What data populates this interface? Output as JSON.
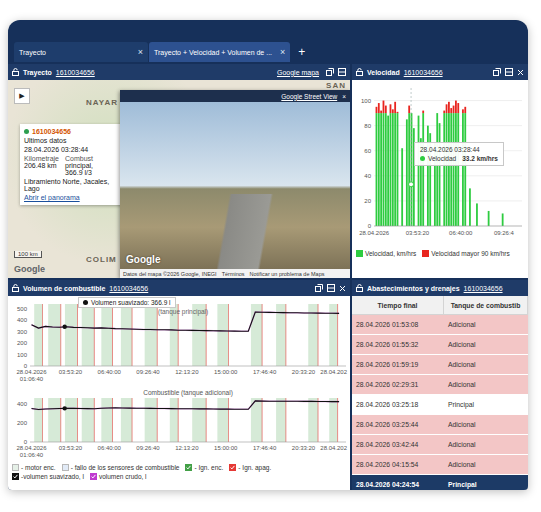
{
  "tabs": [
    {
      "label": "Trayecto",
      "close": "×",
      "selected": false
    },
    {
      "label": "Trayecto + Velocidad + Volumen de ...",
      "close": "×",
      "selected": true
    }
  ],
  "new_tab": "+",
  "map_panel": {
    "title": "Trayecto",
    "unit_id": "1610034656",
    "link": "Google mapa",
    "play": "▶",
    "places": [
      {
        "label": "NAYAR"
      },
      {
        "label": "SAN"
      },
      {
        "label": "COLIM"
      }
    ],
    "scale": "100 km",
    "logo": "Google",
    "info": {
      "unit": "1610034656",
      "status_color": "#2e9e4f",
      "heading": "Ultimos datos",
      "time": "28.04.2026 03:28:44",
      "fields": [
        {
          "label": "Kilometraje",
          "lines": [
            "206.48 km"
          ]
        },
        {
          "label": "Combust",
          "lines": [
            "principal,",
            "366.9 l/3"
          ]
        }
      ],
      "address": "Libramiento Norte, Jacales, Lago",
      "link": "Abrir el panorama"
    },
    "street_view": {
      "title": "Google Street View",
      "close": "×",
      "logo": "Google",
      "footer": [
        "Datos del mapa ©2026 Google, INEGI",
        "Términos",
        "Notificar un problema de Maps"
      ]
    }
  },
  "speed_panel": {
    "title": "Velocidad",
    "unit_id": "1610034656",
    "y_ticks": [
      "100",
      "80",
      "60",
      "40",
      "20",
      "0"
    ],
    "x_ticks": [
      {
        "lines": [
          "28.04.2026"
        ],
        "hour": 1.11
      },
      {
        "lines": [
          "03:53:20"
        ],
        "hour": 3.89
      },
      {
        "lines": [
          "06:40:00"
        ],
        "hour": 6.67
      },
      {
        "lines": [
          "09:26:4"
        ],
        "hour": 9.44
      }
    ],
    "start_hour": 1.2,
    "step_hour": 0.15,
    "threshold": 90,
    "speeds": [
      95,
      98,
      92,
      100,
      96,
      88,
      97,
      93,
      99,
      91,
      0,
      62,
      0,
      85,
      96,
      90,
      78,
      0,
      88,
      70,
      92,
      0,
      80,
      74,
      0,
      66,
      90,
      82,
      0,
      92,
      97,
      99,
      94,
      96,
      100,
      98,
      0,
      93,
      95,
      0,
      30,
      0,
      0,
      18,
      0,
      0,
      0,
      0,
      12,
      0,
      0,
      0,
      0,
      0,
      10,
      0,
      0,
      0,
      0,
      0
    ],
    "tooltip": {
      "time": "28.04.2026 03:28:44",
      "label": "Velocidad",
      "value": "33.2 km/hrs",
      "hour": 3.48,
      "color": "#2ecc40"
    },
    "legend": [
      {
        "label": "Velocidad, km/hrs",
        "color": "#2ecc40"
      },
      {
        "label": "Velocidad mayor 90 km/hrs",
        "color": "#e8251f"
      }
    ]
  },
  "fuel_panel": {
    "title": "Volumen de combustible",
    "unit_id": "1610034656",
    "tooltip": {
      "label": "Volumen suavizado: 366.9 l",
      "subtitle": "(tanque principal)",
      "hour": 3.48
    },
    "x_ticks": [
      {
        "lines": [
          "28.04.2026",
          "01:06:40"
        ],
        "hour": 1.11
      },
      {
        "lines": [
          "03:53:20"
        ],
        "hour": 3.89
      },
      {
        "lines": [
          "06:40:00"
        ],
        "hour": 6.67
      },
      {
        "lines": [
          "09:26:40"
        ],
        "hour": 9.44
      },
      {
        "lines": [
          "12:13:20"
        ],
        "hour": 12.22
      },
      {
        "lines": [
          "15:00:00"
        ],
        "hour": 15.0
      },
      {
        "lines": [
          "17:46:40"
        ],
        "hour": 17.78
      },
      {
        "lines": [
          "20:33:20"
        ],
        "hour": 20.56
      },
      {
        "lines": [
          "28.04.202"
        ],
        "hour": 23.33
      }
    ],
    "start_hour": 1.11,
    "step_hour": 0.5,
    "charts": [
      {
        "y_ticks": [
          "500",
          "400",
          "300",
          "200",
          "100",
          "0"
        ],
        "values": [
          360,
          330,
          345,
          340,
          338,
          342,
          336,
          335,
          333,
          330,
          332,
          328,
          326,
          325,
          322,
          320,
          318,
          318,
          316,
          315,
          314,
          312,
          311,
          310,
          309,
          308,
          307,
          306,
          305,
          304,
          303,
          302,
          470,
          468,
          467,
          466,
          465,
          464,
          463,
          462,
          462,
          461,
          460,
          459,
          458
        ]
      },
      {
        "title": "Combustible (tanque adicional)",
        "y_ticks": [
          "400",
          "200",
          "0"
        ],
        "values": [
          350,
          340,
          345,
          348,
          350,
          352,
          351,
          350,
          349,
          348,
          352,
          355,
          356,
          355,
          354,
          353,
          352,
          351,
          350,
          350,
          349,
          348,
          348,
          347,
          346,
          346,
          345,
          344,
          344,
          343,
          343,
          342,
          430,
          428,
          427,
          426,
          426,
          425,
          425,
          424,
          424,
          423,
          423,
          422,
          422
        ]
      }
    ],
    "ignition_on": [
      [
        1.3,
        1.9
      ],
      [
        2.3,
        3.2
      ],
      [
        3.5,
        4.4
      ],
      [
        4.7,
        5.6
      ],
      [
        6.1,
        6.9
      ],
      [
        7.5,
        8.3
      ],
      [
        9.2,
        10.1
      ],
      [
        11.0,
        11.6
      ],
      [
        12.6,
        13.6
      ],
      [
        14.4,
        15.2
      ],
      [
        16.8,
        17.6
      ],
      [
        18.6,
        19.3
      ],
      [
        20.9,
        21.6
      ],
      [
        22.4,
        23.0
      ]
    ],
    "ignition_off": [
      1.9,
      3.2,
      4.4,
      5.6,
      6.9,
      8.3,
      10.1,
      11.6,
      13.6,
      15.2,
      17.6,
      19.3,
      21.6,
      23.0
    ],
    "legend": [
      {
        "label": "- motor enc.",
        "color": "#cfe3d2",
        "checked": false
      },
      {
        "label": "- fallo de los sensores de combustible",
        "color": "#c9daf0",
        "checked": false
      },
      {
        "label": "- Ign. enc.",
        "color": "#43a047",
        "checked": true
      },
      {
        "label": "- Ign. apag.",
        "color": "#e53935",
        "checked": true
      },
      {
        "label": "-volumen suavizado, l",
        "color": "#111111",
        "checked": true
      },
      {
        "label": "volumen crudo, l",
        "color": "#c03ad0",
        "checked": true
      }
    ]
  },
  "events_panel": {
    "title": "Abastecimientos y drenajes",
    "unit_id": "1610034656",
    "columns": [
      "Tiempo final",
      "Tanque de combustib"
    ],
    "rows": [
      {
        "time": "28.04.2026 01:53:08",
        "tank": "Adicional",
        "kind": "drenaje",
        "selected": false
      },
      {
        "time": "28.04.2026 01:55:32",
        "tank": "Adicional",
        "kind": "drenaje",
        "selected": false
      },
      {
        "time": "28.04.2026 01:59:19",
        "tank": "Adicional",
        "kind": "drenaje",
        "selected": false
      },
      {
        "time": "28.04.2026 02:29:31",
        "tank": "Adicional",
        "kind": "drenaje",
        "selected": false
      },
      {
        "time": "28.04.2026 03:25:18",
        "tank": "Principal",
        "kind": "abastecimiento",
        "selected": false
      },
      {
        "time": "28.04.2026 03:25:44",
        "tank": "Adicional",
        "kind": "drenaje",
        "selected": false
      },
      {
        "time": "28.04.2026 03:42:44",
        "tank": "Adicional",
        "kind": "drenaje",
        "selected": false
      },
      {
        "time": "28.04.2026 04:15:54",
        "tank": "Adicional",
        "kind": "drenaje",
        "selected": false
      },
      {
        "time": "28.04.2026 04:24:54",
        "tank": "Principal",
        "kind": "abastecimiento",
        "selected": true
      }
    ]
  }
}
